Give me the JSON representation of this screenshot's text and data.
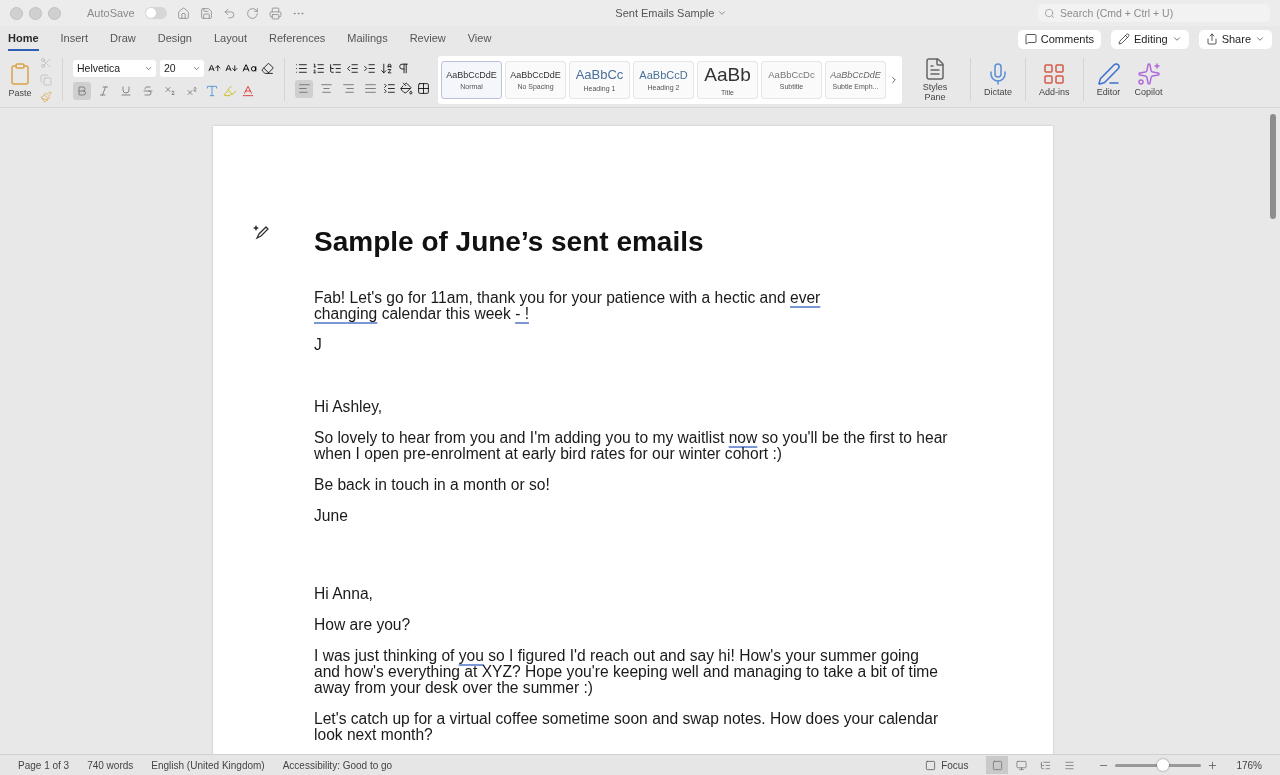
{
  "titlebar": {
    "autosave_label": "AutoSave",
    "autosave_on": false,
    "title": "Sent Emails Sample",
    "search_placeholder": "Search (Cmd + Ctrl + U)"
  },
  "tabs": [
    {
      "label": "Home",
      "selected": true
    },
    {
      "label": "Insert",
      "selected": false
    },
    {
      "label": "Draw",
      "selected": false
    },
    {
      "label": "Design",
      "selected": false
    },
    {
      "label": "Layout",
      "selected": false
    },
    {
      "label": "References",
      "selected": false
    },
    {
      "label": "Mailings",
      "selected": false
    },
    {
      "label": "Review",
      "selected": false
    },
    {
      "label": "View",
      "selected": false
    }
  ],
  "actions": [
    {
      "kind": "comments",
      "label": "Comments"
    },
    {
      "kind": "editing",
      "label": "Editing"
    },
    {
      "kind": "share",
      "label": "Share"
    }
  ],
  "ribbon": {
    "paste_label": "Paste",
    "font_name": "Helvetica",
    "font_size": "20",
    "format_buttons": [
      {
        "kind": "bold",
        "selected": true
      },
      {
        "kind": "italic",
        "selected": false
      },
      {
        "kind": "underline",
        "selected": false
      },
      {
        "kind": "strike",
        "selected": false
      },
      {
        "kind": "subscript",
        "selected": false
      },
      {
        "kind": "superscript",
        "selected": false
      }
    ],
    "align_buttons": [
      {
        "kind": "left",
        "selected": true
      },
      {
        "kind": "center",
        "selected": false
      },
      {
        "kind": "right",
        "selected": false
      },
      {
        "kind": "justify",
        "selected": false
      }
    ],
    "styles": [
      {
        "kind": "normal",
        "preview": "AaBbCcDdE",
        "name": "Normal",
        "selected": true
      },
      {
        "kind": "normal",
        "preview": "AaBbCcDdE",
        "name": "No Spacing",
        "selected": false
      },
      {
        "kind": "heading1",
        "preview": "AaBbCc",
        "name": "Heading 1",
        "selected": false
      },
      {
        "kind": "heading2",
        "preview": "AaBbCcD",
        "name": "Heading 2",
        "selected": false
      },
      {
        "kind": "title",
        "preview": "AaBb",
        "name": "Title",
        "selected": false
      },
      {
        "kind": "subtitle",
        "preview": "AaBbCcDc",
        "name": "Subtitle",
        "selected": false
      },
      {
        "kind": "emphasis",
        "preview": "AaBbCcDdE",
        "name": "Subtle Emph...",
        "selected": false
      }
    ],
    "tools": [
      {
        "kind": "styles",
        "label": "Styles Pane"
      },
      {
        "kind": "dictate",
        "label": "Dictate"
      },
      {
        "kind": "addins",
        "label": "Add-ins"
      },
      {
        "kind": "editor",
        "label": "Editor"
      },
      {
        "kind": "copilot",
        "label": "Copilot"
      }
    ]
  },
  "document": {
    "title": "Sample of June’s sent emails",
    "paragraphs": [
      {
        "kind": "text",
        "segments": [
          {
            "text": "Fab! Let's go for 11am, thank you for your patience with a hectic and ",
            "flagged": false
          },
          {
            "text": "ever\nchanging",
            "flagged": true
          },
          {
            "text": " calendar this week ",
            "flagged": false
          },
          {
            "text": "- !",
            "flagged": true
          }
        ]
      },
      {
        "kind": "text",
        "segments": [
          {
            "text": "J",
            "flagged": false
          }
        ]
      },
      {
        "kind": "break"
      },
      {
        "kind": "text",
        "segments": [
          {
            "text": "Hi Ashley,",
            "flagged": false
          }
        ]
      },
      {
        "kind": "text",
        "segments": [
          {
            "text": "So lovely to hear from you and I'm adding you to my waitlist ",
            "flagged": false
          },
          {
            "text": "now",
            "flagged": true
          },
          {
            "text": " so you'll be the first to hear\nwhen I open pre-enrolment at early bird rates for our winter cohort :)",
            "flagged": false
          }
        ]
      },
      {
        "kind": "text",
        "segments": [
          {
            "text": "Be back in touch in a month or so!",
            "flagged": false
          }
        ]
      },
      {
        "kind": "text",
        "segments": [
          {
            "text": "June",
            "flagged": false
          }
        ]
      },
      {
        "kind": "break"
      },
      {
        "kind": "break"
      },
      {
        "kind": "text",
        "segments": [
          {
            "text": "Hi Anna,",
            "flagged": false
          }
        ]
      },
      {
        "kind": "text",
        "segments": [
          {
            "text": "How are you?",
            "flagged": false
          }
        ]
      },
      {
        "kind": "text",
        "segments": [
          {
            "text": "I was just thinking of ",
            "flagged": false
          },
          {
            "text": "you",
            "flagged": true
          },
          {
            "text": " so I figured I'd reach out and say hi! How's your summer going\nand how's everything at XYZ? Hope you're keeping well and managing to take a bit of time\naway from your desk over the summer :)",
            "flagged": false
          }
        ]
      },
      {
        "kind": "text",
        "segments": [
          {
            "text": "Let's catch up for a virtual coffee sometime soon and swap notes. How does your calendar\nlook next month?",
            "flagged": false
          }
        ]
      }
    ]
  },
  "status": {
    "items": [
      "Page 1 of 3",
      "740 words",
      "English (United Kingdom)",
      "Accessibility: Good to go"
    ],
    "focus_label": "Focus",
    "views": [
      {
        "kind": "print",
        "selected": true
      },
      {
        "kind": "web",
        "selected": false
      },
      {
        "kind": "outline",
        "selected": false
      },
      {
        "kind": "draft",
        "selected": false
      }
    ],
    "zoom": {
      "level": 0.55,
      "reading": "176%"
    }
  }
}
